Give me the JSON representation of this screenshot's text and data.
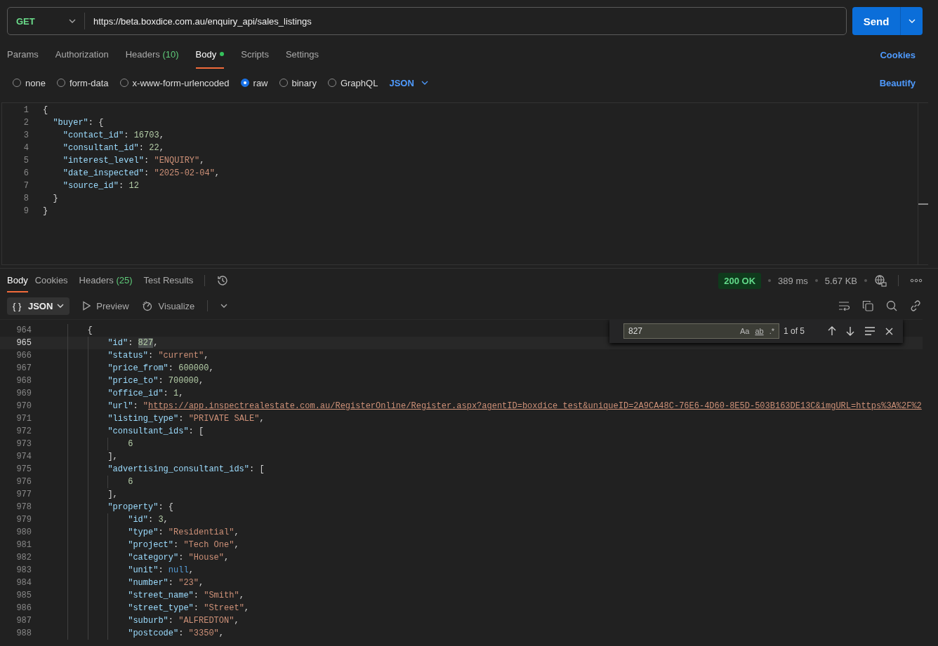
{
  "request": {
    "method": "GET",
    "url": "https://beta.boxdice.com.au/enquiry_api/sales_listings",
    "send": "Send"
  },
  "request_tabs": [
    {
      "label": "Params",
      "selected": false,
      "has_content": false
    },
    {
      "label": "Authorization",
      "selected": false,
      "has_content": false
    },
    {
      "label": "Headers",
      "count": "(10)",
      "selected": false,
      "has_content": false
    },
    {
      "label": "Body",
      "selected": true,
      "has_content": true
    },
    {
      "label": "Scripts",
      "selected": false,
      "has_content": false
    },
    {
      "label": "Settings",
      "selected": false,
      "has_content": false
    }
  ],
  "cookies_link": "Cookies",
  "body_modes": [
    {
      "label": "none",
      "selected": false
    },
    {
      "label": "form-data",
      "selected": false
    },
    {
      "label": "x-www-form-urlencoded",
      "selected": false
    },
    {
      "label": "raw",
      "selected": true
    },
    {
      "label": "binary",
      "selected": false
    },
    {
      "label": "GraphQL",
      "selected": false
    }
  ],
  "body_format": "JSON",
  "beautify": "Beautify",
  "request_body": [
    {
      "n": "1",
      "tokens": [
        {
          "kind": "punct",
          "text": "{"
        }
      ]
    },
    {
      "n": "2",
      "tokens": [
        {
          "kind": "key",
          "text": "  \"buyer\""
        },
        {
          "kind": "punct",
          "text": ": {"
        }
      ]
    },
    {
      "n": "3",
      "tokens": [
        {
          "kind": "key",
          "text": "    \"contact_id\""
        },
        {
          "kind": "punct",
          "text": ": "
        },
        {
          "kind": "num",
          "text": "16703"
        },
        {
          "kind": "punct",
          "text": ","
        }
      ]
    },
    {
      "n": "4",
      "tokens": [
        {
          "kind": "key",
          "text": "    \"consultant_id\""
        },
        {
          "kind": "punct",
          "text": ": "
        },
        {
          "kind": "num",
          "text": "22"
        },
        {
          "kind": "punct",
          "text": ","
        }
      ]
    },
    {
      "n": "5",
      "tokens": [
        {
          "kind": "key",
          "text": "    \"interest_level\""
        },
        {
          "kind": "punct",
          "text": ": "
        },
        {
          "kind": "str",
          "text": "\"ENQUIRY\""
        },
        {
          "kind": "punct",
          "text": ","
        }
      ]
    },
    {
      "n": "6",
      "tokens": [
        {
          "kind": "key",
          "text": "    \"date_inspected\""
        },
        {
          "kind": "punct",
          "text": ": "
        },
        {
          "kind": "str",
          "text": "\"2025-02-04\""
        },
        {
          "kind": "punct",
          "text": ","
        }
      ]
    },
    {
      "n": "7",
      "tokens": [
        {
          "kind": "key",
          "text": "    \"source_id\""
        },
        {
          "kind": "punct",
          "text": ": "
        },
        {
          "kind": "num",
          "text": "12"
        }
      ]
    },
    {
      "n": "8",
      "tokens": [
        {
          "kind": "punct",
          "text": "  }"
        }
      ]
    },
    {
      "n": "9",
      "tokens": [
        {
          "kind": "punct",
          "text": "}"
        }
      ]
    }
  ],
  "response_tabs": [
    {
      "label": "Body",
      "selected": true
    },
    {
      "label": "Cookies",
      "selected": false
    },
    {
      "label": "Headers",
      "count": "(25)",
      "selected": false
    },
    {
      "label": "Test Results",
      "selected": false
    }
  ],
  "status": {
    "code": "200 OK",
    "time": "389 ms",
    "size": "5.67 KB"
  },
  "response_toolbar": {
    "format_icon": "{ }",
    "format": "JSON",
    "preview": "Preview",
    "visualize": "Visualize"
  },
  "find": {
    "value": "827",
    "match_case": "Aa",
    "whole_word": "ab",
    "regex": ".*",
    "result": "1 of 5"
  },
  "response_body": [
    {
      "n": "964",
      "active": false,
      "tokens": [
        {
          "kind": "punct",
          "text": "        {"
        }
      ]
    },
    {
      "n": "965",
      "active": true,
      "tokens": [
        {
          "kind": "key",
          "text": "            \"id\""
        },
        {
          "kind": "punct",
          "text": ": "
        },
        {
          "kind": "match",
          "text": "827"
        },
        {
          "kind": "punct",
          "text": ","
        }
      ]
    },
    {
      "n": "966",
      "active": false,
      "tokens": [
        {
          "kind": "key",
          "text": "            \"status\""
        },
        {
          "kind": "punct",
          "text": ": "
        },
        {
          "kind": "str",
          "text": "\"current\""
        },
        {
          "kind": "punct",
          "text": ","
        }
      ]
    },
    {
      "n": "967",
      "active": false,
      "tokens": [
        {
          "kind": "key",
          "text": "            \"price_from\""
        },
        {
          "kind": "punct",
          "text": ": "
        },
        {
          "kind": "num",
          "text": "600000"
        },
        {
          "kind": "punct",
          "text": ","
        }
      ]
    },
    {
      "n": "968",
      "active": false,
      "tokens": [
        {
          "kind": "key",
          "text": "            \"price_to\""
        },
        {
          "kind": "punct",
          "text": ": "
        },
        {
          "kind": "num",
          "text": "700000"
        },
        {
          "kind": "punct",
          "text": ","
        }
      ]
    },
    {
      "n": "969",
      "active": false,
      "tokens": [
        {
          "kind": "key",
          "text": "            \"office_id\""
        },
        {
          "kind": "punct",
          "text": ": "
        },
        {
          "kind": "num",
          "text": "1"
        },
        {
          "kind": "punct",
          "text": ","
        }
      ]
    },
    {
      "n": "970",
      "active": false,
      "tokens": [
        {
          "kind": "key",
          "text": "            \"url\""
        },
        {
          "kind": "punct",
          "text": ": "
        },
        {
          "kind": "str",
          "text": "\""
        },
        {
          "kind": "link",
          "text": "https://app.inspectrealestate.com.au/RegisterOnline/Register.aspx?agentID=boxdice_test&uniqueID=2A9CA48C-76E6-4D60-8E5D-503B163DE13C&imgURL=https%3A%2F%2"
        }
      ]
    },
    {
      "n": "971",
      "active": false,
      "tokens": [
        {
          "kind": "key",
          "text": "            \"listing_type\""
        },
        {
          "kind": "punct",
          "text": ": "
        },
        {
          "kind": "str",
          "text": "\"PRIVATE SALE\""
        },
        {
          "kind": "punct",
          "text": ","
        }
      ]
    },
    {
      "n": "972",
      "active": false,
      "tokens": [
        {
          "kind": "key",
          "text": "            \"consultant_ids\""
        },
        {
          "kind": "punct",
          "text": ": ["
        }
      ]
    },
    {
      "n": "973",
      "active": false,
      "tokens": [
        {
          "kind": "num",
          "text": "                6"
        }
      ]
    },
    {
      "n": "974",
      "active": false,
      "tokens": [
        {
          "kind": "punct",
          "text": "            ],"
        }
      ]
    },
    {
      "n": "975",
      "active": false,
      "tokens": [
        {
          "kind": "key",
          "text": "            \"advertising_consultant_ids\""
        },
        {
          "kind": "punct",
          "text": ": ["
        }
      ]
    },
    {
      "n": "976",
      "active": false,
      "tokens": [
        {
          "kind": "num",
          "text": "                6"
        }
      ]
    },
    {
      "n": "977",
      "active": false,
      "tokens": [
        {
          "kind": "punct",
          "text": "            ],"
        }
      ]
    },
    {
      "n": "978",
      "active": false,
      "tokens": [
        {
          "kind": "key",
          "text": "            \"property\""
        },
        {
          "kind": "punct",
          "text": ": {"
        }
      ]
    },
    {
      "n": "979",
      "active": false,
      "tokens": [
        {
          "kind": "key",
          "text": "                \"id\""
        },
        {
          "kind": "punct",
          "text": ": "
        },
        {
          "kind": "num",
          "text": "3"
        },
        {
          "kind": "punct",
          "text": ","
        }
      ]
    },
    {
      "n": "980",
      "active": false,
      "tokens": [
        {
          "kind": "key",
          "text": "                \"type\""
        },
        {
          "kind": "punct",
          "text": ": "
        },
        {
          "kind": "str",
          "text": "\"Residential\""
        },
        {
          "kind": "punct",
          "text": ","
        }
      ]
    },
    {
      "n": "981",
      "active": false,
      "tokens": [
        {
          "kind": "key",
          "text": "                \"project\""
        },
        {
          "kind": "punct",
          "text": ": "
        },
        {
          "kind": "str",
          "text": "\"Tech One\""
        },
        {
          "kind": "punct",
          "text": ","
        }
      ]
    },
    {
      "n": "982",
      "active": false,
      "tokens": [
        {
          "kind": "key",
          "text": "                \"category\""
        },
        {
          "kind": "punct",
          "text": ": "
        },
        {
          "kind": "str",
          "text": "\"House\""
        },
        {
          "kind": "punct",
          "text": ","
        }
      ]
    },
    {
      "n": "983",
      "active": false,
      "tokens": [
        {
          "kind": "key",
          "text": "                \"unit\""
        },
        {
          "kind": "punct",
          "text": ": "
        },
        {
          "kind": "null",
          "text": "null"
        },
        {
          "kind": "punct",
          "text": ","
        }
      ]
    },
    {
      "n": "984",
      "active": false,
      "tokens": [
        {
          "kind": "key",
          "text": "                \"number\""
        },
        {
          "kind": "punct",
          "text": ": "
        },
        {
          "kind": "str",
          "text": "\"23\""
        },
        {
          "kind": "punct",
          "text": ","
        }
      ]
    },
    {
      "n": "985",
      "active": false,
      "tokens": [
        {
          "kind": "key",
          "text": "                \"street_name\""
        },
        {
          "kind": "punct",
          "text": ": "
        },
        {
          "kind": "str",
          "text": "\"Smith\""
        },
        {
          "kind": "punct",
          "text": ","
        }
      ]
    },
    {
      "n": "986",
      "active": false,
      "tokens": [
        {
          "kind": "key",
          "text": "                \"street_type\""
        },
        {
          "kind": "punct",
          "text": ": "
        },
        {
          "kind": "str",
          "text": "\"Street\""
        },
        {
          "kind": "punct",
          "text": ","
        }
      ]
    },
    {
      "n": "987",
      "active": false,
      "tokens": [
        {
          "kind": "key",
          "text": "                \"suburb\""
        },
        {
          "kind": "punct",
          "text": ": "
        },
        {
          "kind": "str",
          "text": "\"ALFREDTON\""
        },
        {
          "kind": "punct",
          "text": ","
        }
      ]
    },
    {
      "n": "988",
      "active": false,
      "tokens": [
        {
          "kind": "key",
          "text": "                \"postcode\""
        },
        {
          "kind": "punct",
          "text": ": "
        },
        {
          "kind": "str",
          "text": "\"3350\""
        },
        {
          "kind": "punct",
          "text": ","
        }
      ]
    }
  ]
}
